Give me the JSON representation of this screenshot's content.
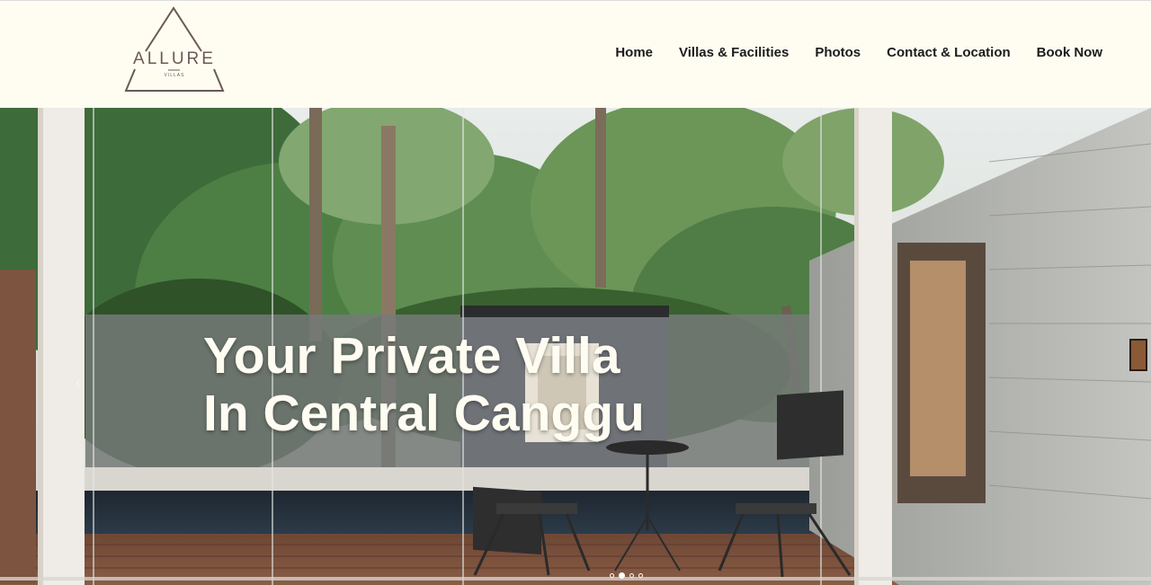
{
  "brand": {
    "name": "ALLURE",
    "tagline": "VILLAS"
  },
  "nav": {
    "items": [
      {
        "label": "Home"
      },
      {
        "label": "Villas & Facilities"
      },
      {
        "label": "Photos"
      },
      {
        "label": "Contact & Location"
      },
      {
        "label": "Book Now"
      }
    ]
  },
  "hero": {
    "headline_line1": "Your Private Villa",
    "headline_line2": "In Central Canggu",
    "slides": 4,
    "active_slide": 2
  },
  "colors": {
    "background": "#fffdf2",
    "nav_text": "#1c1c1c",
    "headline": "#fffdf2",
    "logo": "#6b5a55"
  }
}
